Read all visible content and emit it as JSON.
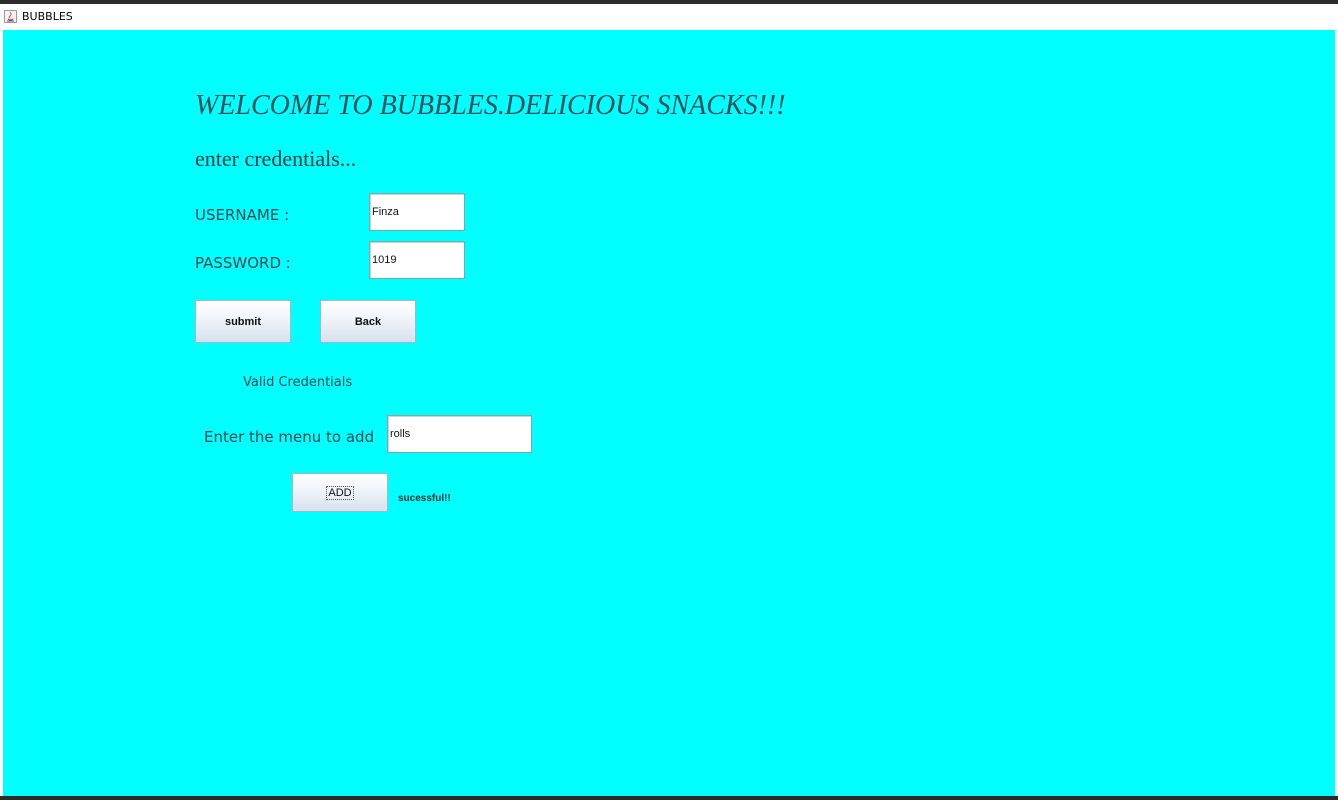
{
  "window": {
    "title": "BUBBLES"
  },
  "form": {
    "welcome": "WELCOME TO BUBBLES.DELICIOUS SNACKS!!!",
    "subheading": "enter credentials...",
    "username_label": "USERNAME :",
    "username_value": "Finza",
    "password_label": "PASSWORD :",
    "password_value": "1019",
    "submit_label": "submit",
    "back_label": "Back",
    "validation_message": "Valid Credentials",
    "menu_label": "Enter the menu to add",
    "menu_value": "rolls",
    "add_label": "ADD",
    "add_status": "sucessful!!"
  },
  "colors": {
    "background": "#00ffff",
    "heading_text": "#2d4f5c"
  }
}
